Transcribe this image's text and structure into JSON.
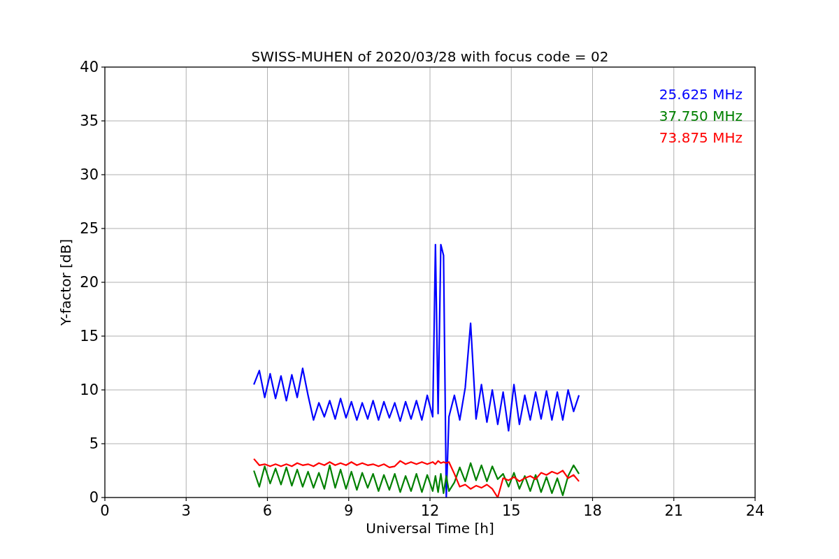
{
  "figure": {
    "chart_data": {
      "type": "line",
      "title": "SWISS-MUHEN of 2020/03/28 with focus code = 02",
      "xlabel": "Universal Time [h]",
      "ylabel": "Y-factor [dB]",
      "x": [
        5.5,
        5.7,
        5.9,
        6.1,
        6.3,
        6.5,
        6.7,
        6.9,
        7.1,
        7.3,
        7.5,
        7.7,
        7.9,
        8.1,
        8.3,
        8.5,
        8.7,
        8.9,
        9.1,
        9.3,
        9.5,
        9.7,
        9.9,
        10.1,
        10.3,
        10.5,
        10.7,
        10.9,
        11.1,
        11.3,
        11.5,
        11.7,
        11.9,
        12.1,
        12.2,
        12.3,
        12.4,
        12.5,
        12.6,
        12.7,
        12.9,
        13.1,
        13.3,
        13.5,
        13.7,
        13.9,
        14.1,
        14.3,
        14.5,
        14.7,
        14.9,
        15.1,
        15.3,
        15.5,
        15.7,
        15.9,
        16.1,
        16.3,
        16.5,
        16.7,
        16.9,
        17.1,
        17.3,
        17.5
      ],
      "series": [
        {
          "name": "25.625 MHz",
          "color": "#0000ff",
          "values": [
            10.5,
            11.8,
            9.3,
            11.5,
            9.2,
            11.3,
            9.0,
            11.4,
            9.3,
            12.0,
            9.5,
            7.2,
            8.8,
            7.5,
            9.0,
            7.3,
            9.2,
            7.4,
            8.9,
            7.2,
            8.8,
            7.3,
            9.0,
            7.2,
            8.9,
            7.4,
            8.8,
            7.1,
            8.9,
            7.3,
            9.0,
            7.2,
            9.5,
            7.5,
            23.5,
            7.8,
            23.5,
            22.5,
            0.0,
            7.5,
            9.5,
            7.2,
            10.2,
            16.2,
            7.3,
            10.5,
            7.0,
            10.0,
            6.8,
            9.8,
            6.2,
            10.5,
            6.8,
            9.5,
            7.2,
            9.8,
            7.3,
            9.9,
            7.2,
            9.8,
            7.2,
            10.0,
            8.0,
            9.5
          ]
        },
        {
          "name": "37.750 MHz",
          "color": "#008000",
          "values": [
            2.5,
            1.0,
            2.9,
            1.3,
            2.7,
            1.2,
            2.8,
            1.1,
            2.6,
            1.0,
            2.4,
            0.9,
            2.3,
            0.8,
            3.0,
            0.9,
            2.6,
            0.8,
            2.4,
            0.7,
            2.3,
            0.9,
            2.2,
            0.6,
            2.1,
            0.7,
            2.2,
            0.5,
            2.0,
            0.6,
            2.2,
            0.5,
            2.1,
            0.6,
            2.0,
            0.5,
            2.2,
            0.4,
            2.0,
            0.6,
            1.4,
            2.8,
            1.5,
            3.2,
            1.6,
            3.0,
            1.5,
            2.9,
            1.7,
            2.2,
            1.0,
            2.3,
            0.8,
            2.0,
            0.6,
            2.1,
            0.5,
            1.9,
            0.4,
            1.8,
            0.2,
            2.0,
            3.0,
            2.2
          ]
        },
        {
          "name": "73.875 MHz",
          "color": "#ff0000",
          "values": [
            3.6,
            3.0,
            3.1,
            2.9,
            3.1,
            2.9,
            3.1,
            2.9,
            3.2,
            3.0,
            3.1,
            2.9,
            3.2,
            3.0,
            3.3,
            3.0,
            3.2,
            3.0,
            3.3,
            3.0,
            3.2,
            3.0,
            3.1,
            2.9,
            3.1,
            2.8,
            2.9,
            3.4,
            3.1,
            3.3,
            3.1,
            3.3,
            3.1,
            3.3,
            3.1,
            3.4,
            3.2,
            3.3,
            3.2,
            3.3,
            2.2,
            1.0,
            1.2,
            0.8,
            1.1,
            0.9,
            1.2,
            0.8,
            0.0,
            1.8,
            1.6,
            1.9,
            1.5,
            1.8,
            2.0,
            1.7,
            2.3,
            2.1,
            2.4,
            2.2,
            2.5,
            1.8,
            2.1,
            1.5
          ]
        }
      ],
      "grid": true,
      "xlim": [
        0,
        24
      ],
      "ylim": [
        0,
        40
      ],
      "xticks": [
        0,
        3,
        6,
        9,
        12,
        15,
        18,
        21,
        24
      ],
      "yticks": [
        0,
        5,
        10,
        15,
        20,
        25,
        30,
        35,
        40
      ]
    }
  }
}
